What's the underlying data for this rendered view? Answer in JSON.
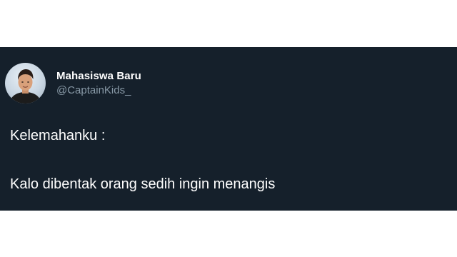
{
  "tweet": {
    "author": {
      "display_name": "Mahasiswa Baru",
      "handle": "@CaptainKids_"
    },
    "lines": [
      "Kelemahanku :",
      "Kalo dibentak orang sedih ingin menangis"
    ]
  },
  "colors": {
    "page_background": "#ffffff",
    "card_background": "#15202b",
    "primary_text": "#ffffff",
    "secondary_text": "#8899a6"
  }
}
